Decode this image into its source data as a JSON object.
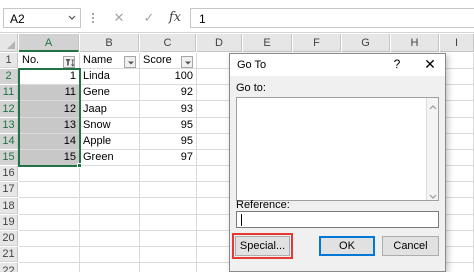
{
  "formula_bar": {
    "name_box": "A2",
    "cancel_icon": "✕",
    "enter_icon": "✓",
    "fx_label": "fx",
    "value": "1"
  },
  "columns": [
    "A",
    "B",
    "C",
    "D",
    "E",
    "F",
    "G",
    "H",
    "I"
  ],
  "rows": [
    "1",
    "2",
    "11",
    "12",
    "13",
    "14",
    "15",
    "16",
    "17",
    "18",
    "19",
    "20",
    "21",
    "22",
    "23"
  ],
  "headers": [
    "No.",
    "Name",
    "Score"
  ],
  "records": [
    {
      "no": "1",
      "name": "Linda",
      "score": "100"
    },
    {
      "no": "11",
      "name": "Gene",
      "score": "92"
    },
    {
      "no": "12",
      "name": "Jaap",
      "score": "93"
    },
    {
      "no": "13",
      "name": "Snow",
      "score": "95"
    },
    {
      "no": "14",
      "name": "Apple",
      "score": "95"
    },
    {
      "no": "15",
      "name": "Green",
      "score": "97"
    }
  ],
  "dialog": {
    "title": "Go To",
    "help": "?",
    "close": "✕",
    "goto_label": "Go to:",
    "reference_label": "Reference:",
    "reference_value": "",
    "special_button": "Special...",
    "ok_button": "OK",
    "cancel_button": "Cancel"
  },
  "colors": {
    "excel_green": "#217346",
    "filtered_row_blue": "#1f4e9c",
    "highlight_red": "#e53935",
    "selection_gray": "#c8c8c8"
  }
}
